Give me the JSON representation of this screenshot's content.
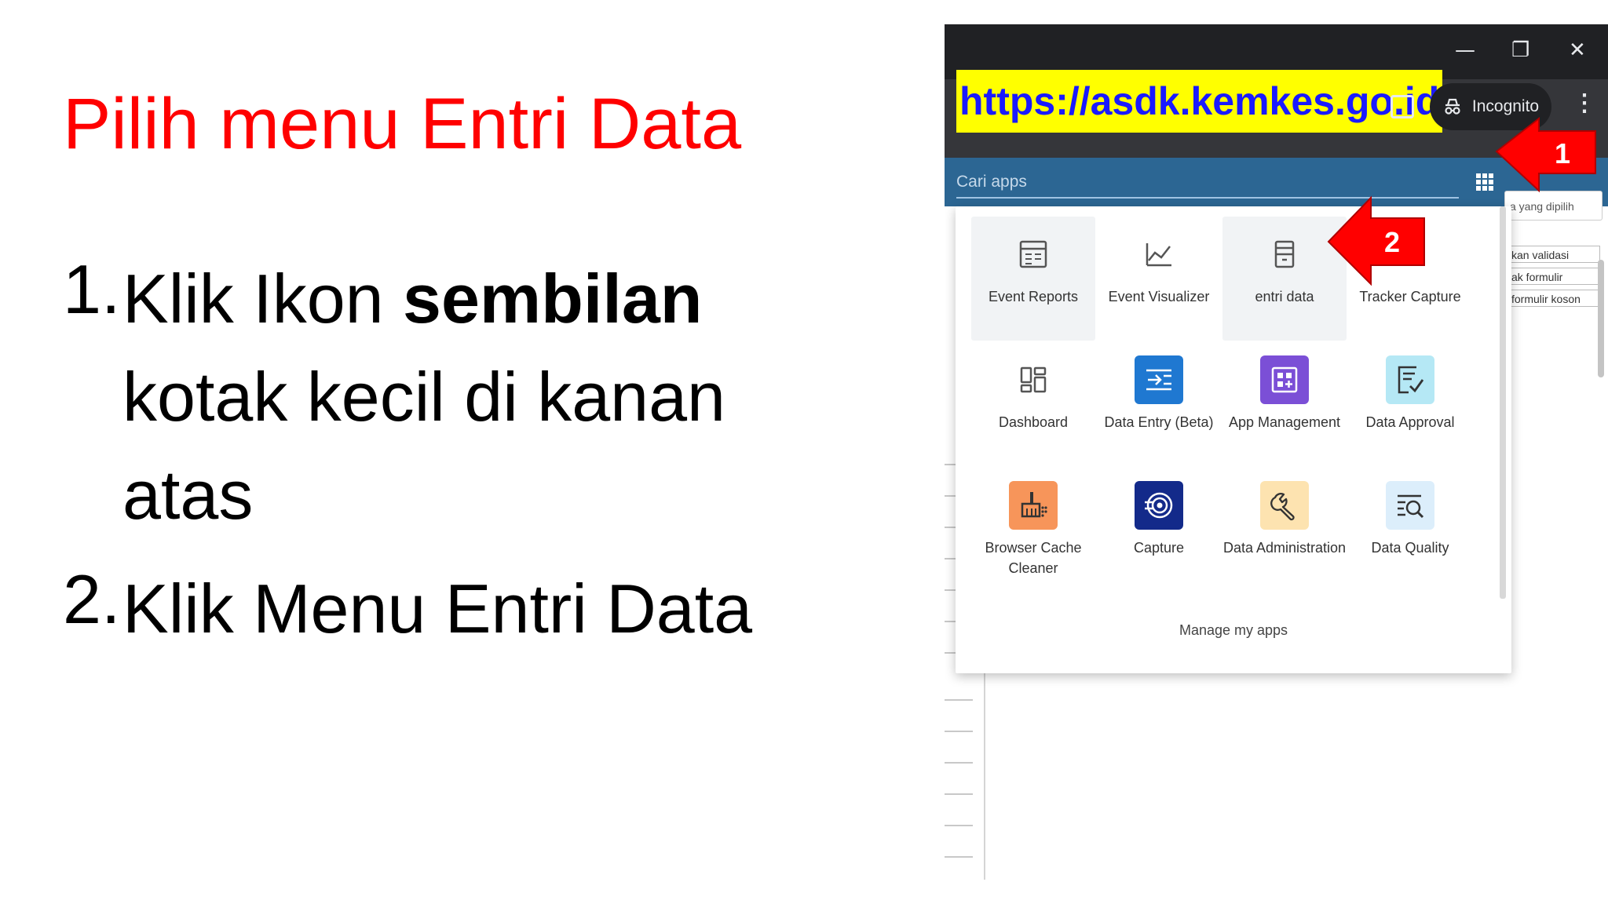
{
  "slide": {
    "title": "Pilih menu Entri Data",
    "steps": [
      {
        "num": "1.",
        "pre": "Klik Ikon ",
        "bold": "sembilan",
        "post": " kotak kecil di kanan atas"
      },
      {
        "num": "2.",
        "pre": "Klik Menu Entri Data",
        "bold": "",
        "post": ""
      }
    ]
  },
  "browser": {
    "url": "https://asdk.kemkes.go.id",
    "incognito_label": "Incognito",
    "window_controls": {
      "minimize": "—",
      "restore": "❐",
      "close": "✕"
    }
  },
  "app_header": {
    "search_placeholder": "Cari apps"
  },
  "background_page": {
    "buttons": [
      "kan validasi",
      "ak formulir",
      "formulir koson"
    ],
    "filter_text": "a yang dipilih"
  },
  "app_menu": {
    "apps": [
      {
        "label": "Event Reports",
        "icon": "event-reports-icon"
      },
      {
        "label": "Event Visualizer",
        "icon": "event-visualizer-icon"
      },
      {
        "label": "entri data",
        "icon": "entri-data-icon"
      },
      {
        "label": "Tracker Capture",
        "icon": "tracker-capture-icon"
      },
      {
        "label": "Dashboard",
        "icon": "dashboard-icon"
      },
      {
        "label": "Data Entry (Beta)",
        "icon": "data-entry-icon"
      },
      {
        "label": "App Management",
        "icon": "app-management-icon"
      },
      {
        "label": "Data Approval",
        "icon": "data-approval-icon"
      },
      {
        "label": "Browser Cache Cleaner",
        "icon": "browser-cache-cleaner-icon"
      },
      {
        "label": "Capture",
        "icon": "capture-icon"
      },
      {
        "label": "Data Administration",
        "icon": "data-administration-icon"
      },
      {
        "label": "Data Quality",
        "icon": "data-quality-icon"
      }
    ],
    "manage_label": "Manage my apps"
  },
  "annotations": {
    "arrow1_label": "1",
    "arrow2_label": "2"
  },
  "colors": {
    "title_red": "#ff0000",
    "url_highlight": "#ffff00",
    "url_text": "#1a1aff",
    "header_blue": "#2c6693",
    "arrow_red": "#ff0000",
    "data_entry_blue": "#1f78d1",
    "app_mgmt_purple": "#7b4fd6",
    "approval_cyan": "#b5e8f5",
    "cache_orange": "#f7955a",
    "capture_navy": "#132a8a",
    "admin_yellow": "#fde3b0",
    "quality_blue": "#dceefb"
  }
}
